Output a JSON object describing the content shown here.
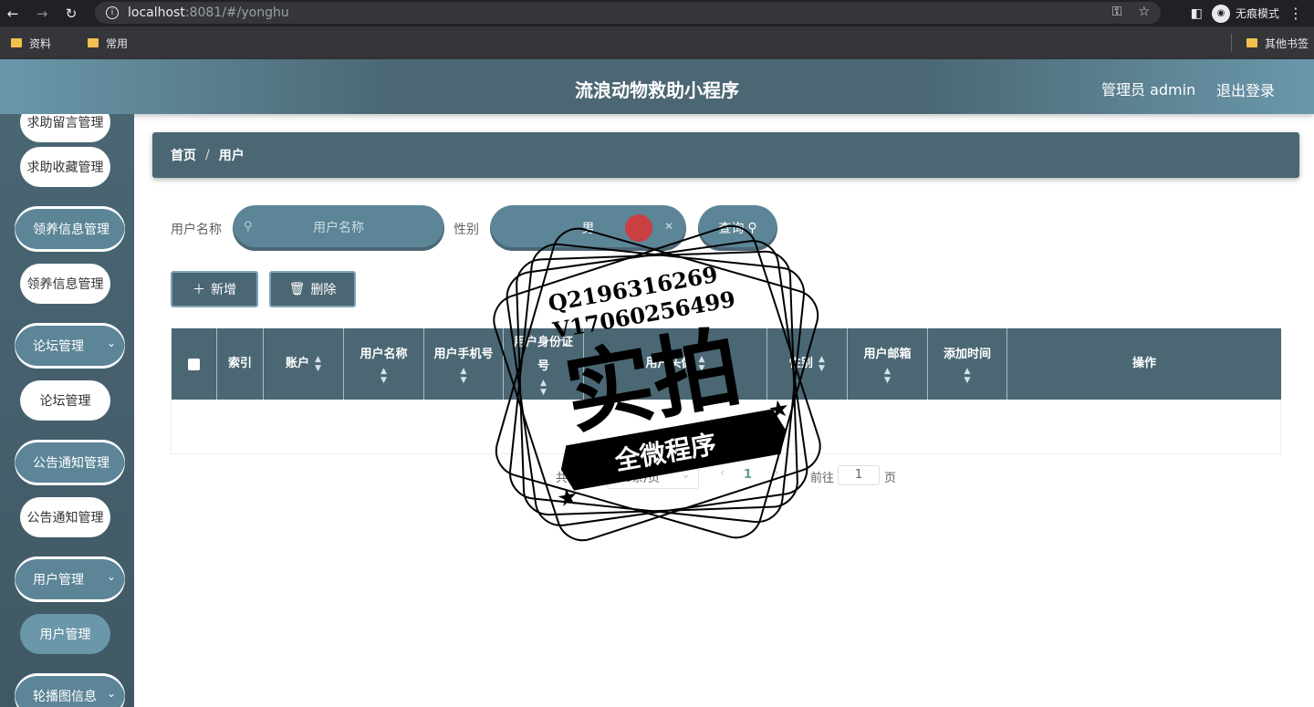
{
  "browser": {
    "url_host": "localhost",
    "url_port_path": ":8081/#/yonghu",
    "incognito_label": "无痕模式",
    "bookmarks": [
      "资料",
      "常用"
    ],
    "other_bookmarks": "其他书签"
  },
  "header": {
    "title": "流浪动物救助小程序",
    "admin": "管理员 admin",
    "logout": "退出登录"
  },
  "sidebar": {
    "items": [
      {
        "label": "求助留言管理",
        "type": "item"
      },
      {
        "label": "求助收藏管理",
        "type": "item"
      },
      {
        "label": "领养信息管理",
        "type": "group"
      },
      {
        "label": "领养信息管理",
        "type": "item"
      },
      {
        "label": "论坛管理",
        "type": "group"
      },
      {
        "label": "论坛管理",
        "type": "item"
      },
      {
        "label": "公告通知管理",
        "type": "group"
      },
      {
        "label": "公告通知管理",
        "type": "item"
      },
      {
        "label": "用户管理",
        "type": "group"
      },
      {
        "label": "用户管理",
        "type": "item"
      },
      {
        "label": "轮播图信息",
        "type": "group"
      }
    ]
  },
  "breadcrumb": {
    "home": "首页",
    "separator": "/",
    "current": "用户"
  },
  "search": {
    "name_label": "用户名称",
    "name_placeholder": "用户名称",
    "gender_label": "性别",
    "gender_value": "男",
    "query_button": "查询"
  },
  "actions": {
    "add": "新增",
    "delete": "删除"
  },
  "table": {
    "columns": [
      {
        "label": "",
        "sortable": false
      },
      {
        "label": "索引",
        "sortable": false
      },
      {
        "label": "账户",
        "sortable": true
      },
      {
        "label": "用户名称",
        "sortable": true
      },
      {
        "label": "用户手机号",
        "sortable": true
      },
      {
        "label": "用户身份证号",
        "sortable": true
      },
      {
        "label": "用户头像",
        "sortable": true
      },
      {
        "label": "性别",
        "sortable": true
      },
      {
        "label": "用户邮箱",
        "sortable": true
      },
      {
        "label": "添加时间",
        "sortable": true
      },
      {
        "label": "操作",
        "sortable": false
      }
    ],
    "rows": []
  },
  "pagination": {
    "total_text": "共 0 条",
    "page_size_text": "10条/页",
    "current_page": "1",
    "goto_label": "前往",
    "goto_value": "1",
    "page_suffix": "页"
  },
  "watermark": {
    "line1": "Q2196316269",
    "line2": "V17060256499",
    "main": "实拍",
    "ribbon": "全微程序"
  }
}
